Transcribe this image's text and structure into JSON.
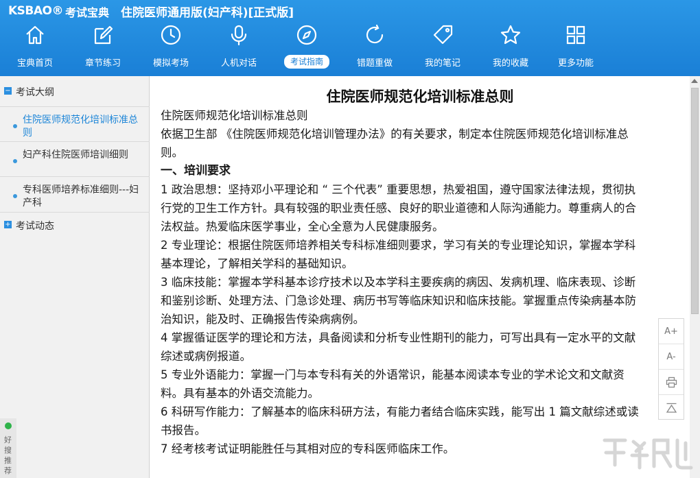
{
  "header": {
    "brand": "KSBAO®",
    "brand_cn": "考试宝典",
    "app_title": "住院医师通用版(妇产科)[正式版]"
  },
  "toolbar": {
    "items": [
      {
        "label": "宝典首页",
        "icon": "home-icon"
      },
      {
        "label": "章节练习",
        "icon": "edit-icon"
      },
      {
        "label": "模拟考场",
        "icon": "clock-icon"
      },
      {
        "label": "人机对话",
        "icon": "microphone-icon"
      },
      {
        "label": "考试指南",
        "icon": "compass-icon",
        "active": true
      },
      {
        "label": "错题重做",
        "icon": "refresh-icon"
      },
      {
        "label": "我的笔记",
        "icon": "tag-icon"
      },
      {
        "label": "我的收藏",
        "icon": "star-icon"
      },
      {
        "label": "更多功能",
        "icon": "grid-icon"
      }
    ]
  },
  "sidebar": {
    "group1": {
      "toggle": "−",
      "label": "考试大纲"
    },
    "items": [
      {
        "label": "住院医师规范化培训标准总则",
        "active": true
      },
      {
        "label": "妇产科住院医师培训细则"
      },
      {
        "label": "专科医师培养标准细则---妇产科"
      }
    ],
    "group2": {
      "toggle": "+",
      "label": "考试动态"
    },
    "hsts": "好搜推荐"
  },
  "doc": {
    "title": "住院医师规范化培训标准总则",
    "lines": [
      "住院医师规范化培训标准总则",
      "依据卫生部 《住院医师规范化培训管理办法》的有关要求，制定本住院医师规范化培训标准总则。",
      "一、培训要求",
      "1 政治思想：坚持邓小平理论和 “ 三个代表” 重要思想，热爱祖国，遵守国家法律法规，贯彻执行党的卫生工作方针。具有较强的职业责任感、良好的职业道德和人际沟通能力。尊重病人的合法权益。热爱临床医学事业，全心全意为人民健康服务。",
      "2 专业理论：根据住院医师培养相关专科标准细则要求，学习有关的专业理论知识，掌握本学科基本理论，了解相关学科的基础知识。",
      "3 临床技能：掌握本学科基本诊疗技术以及本学科主要疾病的病因、发病机理、临床表现、诊断和鉴别诊断、处理方法、门急诊处理、病历书写等临床知识和临床技能。掌握重点传染病基本防治知识，能及时、正确报告传染病病例。",
      "4 掌握循证医学的理论和方法，具备阅读和分析专业性期刊的能力，可写出具有一定水平的文献综述或病例报道。",
      "5 专业外语能力：掌握一门与本专科有关的外语常识，能基本阅读本专业的学术论文和文献资料。具有基本的外语交流能力。",
      "6 科研写作能力：了解基本的临床科研方法，有能力者结合临床实践，能写出 1 篇文献综述或读书报告。",
      "7 经考核考试证明能胜任与其相对应的专科医师临床工作。"
    ]
  },
  "float_tools": {
    "font_up": "A+",
    "font_down": "A-"
  }
}
